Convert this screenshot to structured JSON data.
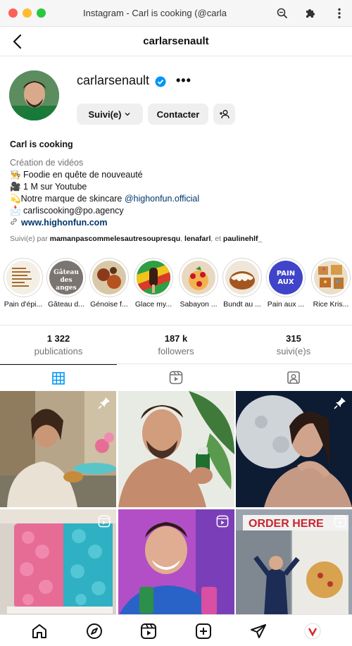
{
  "window": {
    "title": "Instagram - Carl is cooking (@carla",
    "icons": [
      "zoom-icon",
      "extensions-icon",
      "kebab-menu-icon"
    ]
  },
  "header": {
    "username": "carlarsenault"
  },
  "profile": {
    "username": "carlarsenault",
    "verified": true,
    "more_label": "•••",
    "follow_button": "Suivi(e)",
    "contact_button": "Contacter",
    "display_name": "Carl is cooking",
    "category": "Création de vidéos",
    "bio_lines": [
      "👨‍🍳 Foodie en quête de nouveauté",
      "🎥 1 M sur Youtube",
      "💫Notre marque de skincare ",
      "📩 carliscooking@po.agency"
    ],
    "bio_mention": "@highonfun.official",
    "link": "www.highonfun.com",
    "followed_by_prefix": "Suivi(e) par ",
    "followed_by_names": [
      "mamanpascommelesautresoupresqu",
      "lenafarl",
      "paulinehlf_"
    ],
    "followed_by_sep1": ", ",
    "followed_by_sep2": ", et "
  },
  "highlights": [
    {
      "label": "Pain d'épi..."
    },
    {
      "label": "Gâteau d..."
    },
    {
      "label": "Génoise f..."
    },
    {
      "label": "Glace my..."
    },
    {
      "label": "Sabayon ..."
    },
    {
      "label": "Bundt au ..."
    },
    {
      "label": "Pain aux ..."
    },
    {
      "label": "Rice Kris..."
    }
  ],
  "highlight_inner_text": {
    "h2": "Gâteau des anges",
    "h7": "PAIN AUX"
  },
  "stats": [
    {
      "value": "1 322",
      "label": "publications"
    },
    {
      "value": "187 k",
      "label": "followers"
    },
    {
      "value": "315",
      "label": "suivi(e)s"
    }
  ],
  "tabs": [
    "posts-grid-icon",
    "reels-icon",
    "tagged-icon"
  ],
  "posts": [
    {
      "type": "pinned"
    },
    {
      "type": "post"
    },
    {
      "type": "pinned"
    },
    {
      "type": "reel"
    },
    {
      "type": "reel"
    },
    {
      "type": "reel"
    }
  ],
  "post_text": {
    "sign": "ORDER HERE"
  },
  "bottom_nav": [
    "home-icon",
    "explore-icon",
    "reels-icon",
    "create-icon",
    "direct-icon",
    "profile-avatar"
  ],
  "colors": {
    "accent": "#0095f6",
    "link": "#00376b",
    "muted": "#737373"
  }
}
